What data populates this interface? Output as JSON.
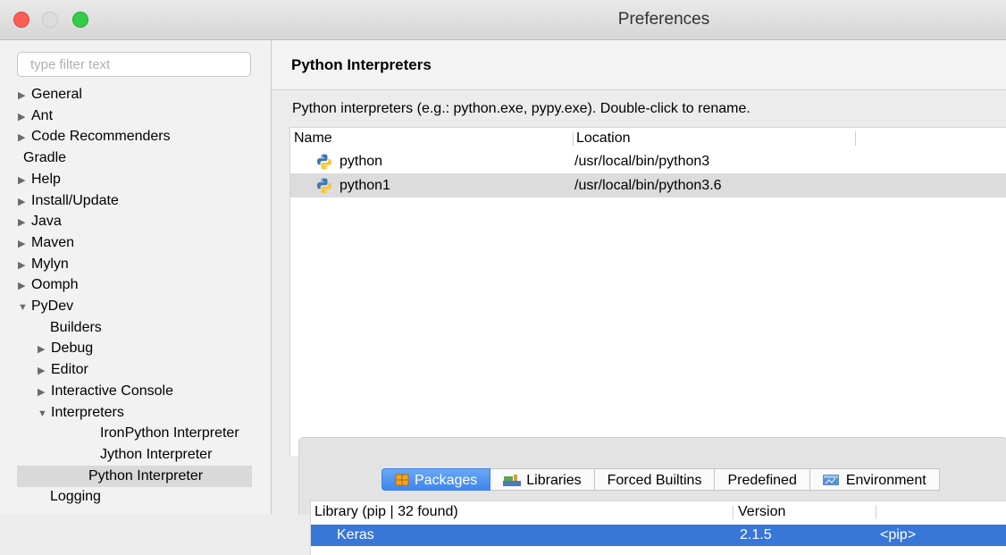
{
  "window": {
    "title": "Preferences"
  },
  "filter": {
    "placeholder": "type filter text"
  },
  "tree": [
    {
      "label": "General",
      "arrow": "▶",
      "indent": 0
    },
    {
      "label": "Ant",
      "arrow": "▶",
      "indent": 0
    },
    {
      "label": "Code Recommenders",
      "arrow": "▶",
      "indent": 0
    },
    {
      "label": "Gradle",
      "arrow": "",
      "indent": 0
    },
    {
      "label": "Help",
      "arrow": "▶",
      "indent": 0
    },
    {
      "label": "Install/Update",
      "arrow": "▶",
      "indent": 0
    },
    {
      "label": "Java",
      "arrow": "▶",
      "indent": 0
    },
    {
      "label": "Maven",
      "arrow": "▶",
      "indent": 0
    },
    {
      "label": "Mylyn",
      "arrow": "▶",
      "indent": 0
    },
    {
      "label": "Oomph",
      "arrow": "▶",
      "indent": 0
    },
    {
      "label": "PyDev",
      "arrow": "▼",
      "indent": 0
    },
    {
      "label": "Builders",
      "arrow": "",
      "indent": 1
    },
    {
      "label": "Debug",
      "arrow": "▶",
      "indent": 1
    },
    {
      "label": "Editor",
      "arrow": "▶",
      "indent": 1
    },
    {
      "label": "Interactive Console",
      "arrow": "▶",
      "indent": 1
    },
    {
      "label": "Interpreters",
      "arrow": "▼",
      "indent": 1
    },
    {
      "label": "IronPython Interpreter",
      "arrow": "",
      "indent": 2
    },
    {
      "label": "Jython Interpreter",
      "arrow": "",
      "indent": 2
    },
    {
      "label": "Python Interpreter",
      "arrow": "",
      "indent": 2,
      "selected": true
    },
    {
      "label": "Logging",
      "arrow": "",
      "indent": 1
    }
  ],
  "page": {
    "title": "Python Interpreters",
    "description": "Python interpreters (e.g.: python.exe, pypy.exe).   Double-click to rename."
  },
  "interpreters": {
    "columns": [
      "Name",
      "Location"
    ],
    "rows": [
      {
        "name": "python",
        "location": "/usr/local/bin/python3"
      },
      {
        "name": "python1",
        "location": "/usr/local/bin/python3.6",
        "selected": true
      }
    ]
  },
  "tabs": [
    {
      "label": "Packages",
      "icon": "packages-icon",
      "active": true
    },
    {
      "label": "Libraries",
      "icon": "libraries-icon"
    },
    {
      "label": "Forced Builtins"
    },
    {
      "label": "Predefined"
    },
    {
      "label": "Environment",
      "icon": "environment-icon"
    }
  ],
  "libraries": {
    "columns": [
      "Library (pip | 32 found)",
      "Version"
    ],
    "rows": [
      {
        "library": "Keras",
        "version": "2.1.5",
        "source": "<pip>",
        "selected": true
      }
    ]
  },
  "colors": {
    "selection": "#3876d8",
    "tab_active": "#4a8ff0"
  }
}
